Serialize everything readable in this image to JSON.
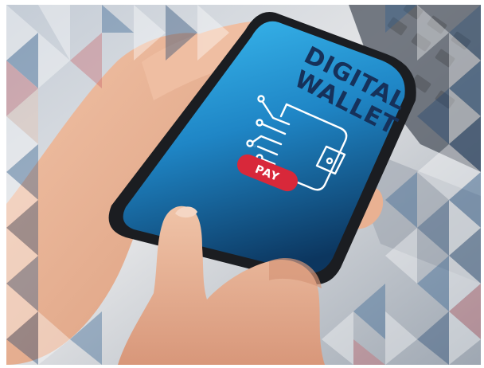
{
  "phone_screen": {
    "title_line_1": "DIGITAL",
    "title_line_2": "WALLET",
    "pay_button_label": "PAY",
    "icon": "wallet-circuit-icon"
  },
  "colors": {
    "screen_top": "#36b3ea",
    "screen_bottom": "#0d3b6e",
    "title_text": "#16315a",
    "icon_stroke": "#ffffff",
    "pay_button": "#d8283a",
    "phone_body": "#1b1d21",
    "skin": "#e8b394"
  }
}
